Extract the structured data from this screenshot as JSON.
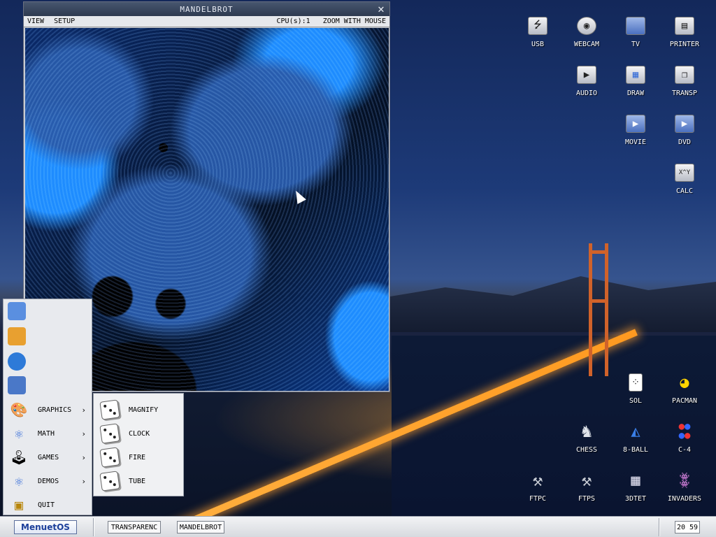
{
  "window": {
    "title": "MANDELBROT",
    "menu_view": "VIEW",
    "menu_setup": "SETUP",
    "cpu": "CPU(s):1",
    "zoom_hint": "ZOOM WITH MOUSE",
    "close_glyph": "✕"
  },
  "start_menu": {
    "items": [
      {
        "label": "GRAPHICS",
        "icon": "palette-icon",
        "arrow": "›"
      },
      {
        "label": "MATH",
        "icon": "molecule-icon",
        "arrow": "›"
      },
      {
        "label": "GAMES",
        "icon": "joystick-icon",
        "arrow": "›"
      },
      {
        "label": "DEMOS",
        "icon": "molecule-icon",
        "arrow": "›"
      },
      {
        "label": "QUIT",
        "icon": "chip-icon",
        "arrow": ""
      }
    ],
    "submenu": [
      "MAGNIFY",
      "CLOCK",
      "FIRE",
      "TUBE"
    ]
  },
  "desktop_icons": {
    "usb": "USB",
    "webcam": "WEBCAM",
    "tv": "TV",
    "printer": "PRINTER",
    "audio": "AUDIO",
    "draw": "DRAW",
    "transp": "TRANSP",
    "movie": "MOVIE",
    "dvd": "DVD",
    "calc": "CALC",
    "calc_glyph": "X^Y",
    "sol": "SOL",
    "pacman": "PACMAN",
    "chess": "CHESS",
    "eightball": "8-BALL",
    "c4": "C-4",
    "ftpc": "FTPC",
    "ftps": "FTPS",
    "tdtet": "3DTET",
    "invaders": "INVADERS"
  },
  "taskbar": {
    "start_label": "MenuetOS",
    "tasks": [
      "TRANSPARENC",
      "MANDELBROT"
    ],
    "clock": "20 59"
  },
  "colors": {
    "accent": "#1e8cff",
    "title_bar": "#2e3a50",
    "start_text": "#1c3f9a"
  }
}
